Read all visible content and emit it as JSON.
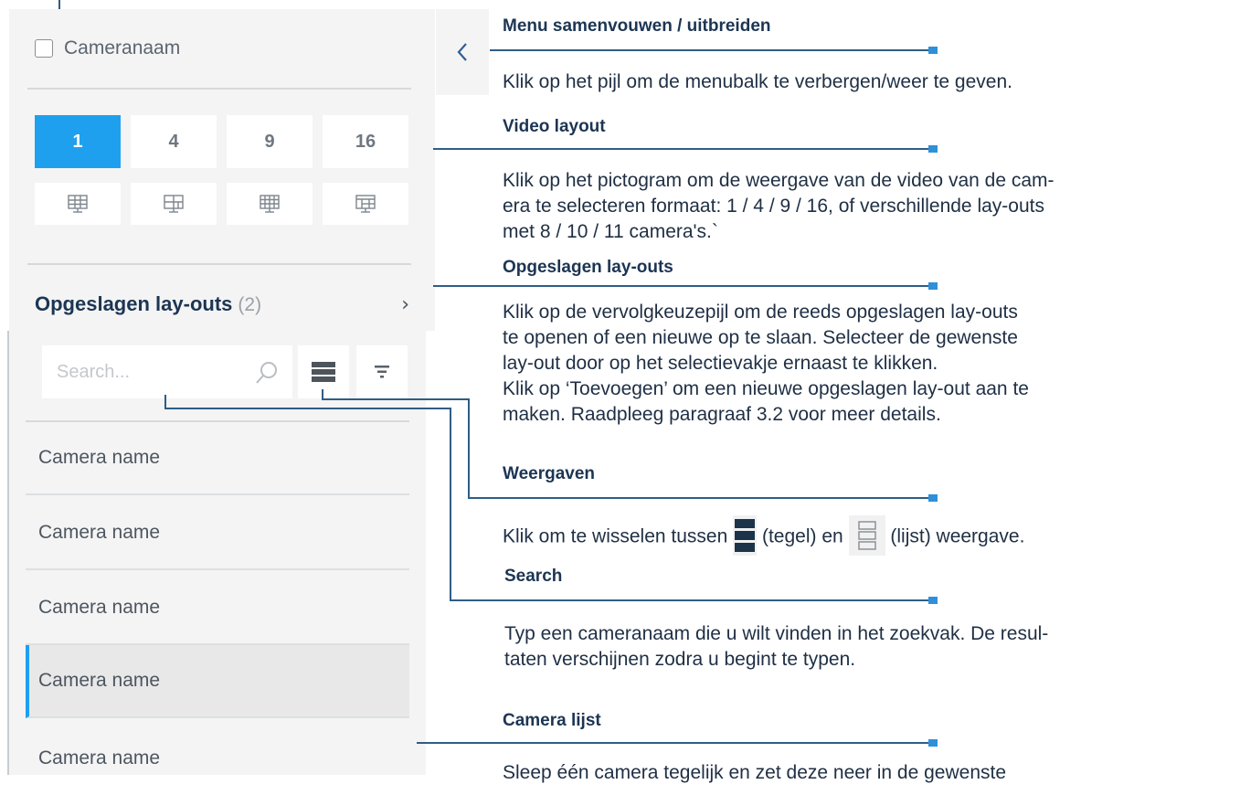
{
  "sidebar": {
    "camera_name_checkbox": {
      "label": "Cameranaam",
      "checked": false
    },
    "layout_buttons": [
      "1",
      "4",
      "9",
      "16"
    ],
    "active_layout": "1",
    "saved_layouts": {
      "title": "Opgeslagen lay-outs",
      "count": "(2)"
    },
    "search": {
      "placeholder": "Search..."
    },
    "camera_list": [
      "Camera name",
      "Camera name",
      "Camera name",
      "Camera name",
      "Camera name"
    ],
    "selected_index": 3,
    "accent_color": "#1ea0ef"
  },
  "icons": {
    "collapse": "chevron-left-icon",
    "saved_layouts_expand": "chevron-right-icon",
    "search": "magnifier-icon",
    "view_toggle": "tile-view-icon",
    "filter": "filter-icon"
  },
  "annotations": {
    "menu": {
      "title": "Menu samenvouwen / uitbreiden",
      "line1": "Klik op het pijl om de menubalk te verbergen/weer te geven."
    },
    "video_layout": {
      "title": "Video layout",
      "line1": "Klik op het pictogram om de weergave van de video van de cam-",
      "line2": "era te selecteren formaat: 1 / 4 / 9 / 16, of verschillende lay-outs",
      "line3": "met 8 / 10 / 11 camera's.`"
    },
    "saved": {
      "title": "Opgeslagen lay-outs",
      "line1": "Klik op de vervolgkeuzepijl om de reeds opgeslagen lay-outs",
      "line2": "te openen of een nieuwe op te slaan. Selecteer de gewenste",
      "line3": "lay-out door op het selectievakje ernaast te klikken.",
      "line4": "Klik op ‘Toevoegen’ om een nieuwe opgeslagen lay-out aan te",
      "line5": "maken. Raadpleeg paragraaf 3.2 voor meer details."
    },
    "views": {
      "title": "Weergaven",
      "part1": "Klik om te wisselen tussen",
      "part2": "(tegel) en",
      "part3": "(lijst) weergave."
    },
    "search": {
      "title": "Search",
      "line1": "Typ een cameranaam die u wilt vinden in het zoekvak. De resul-",
      "line2": "taten verschijnen zodra u begint te typen."
    },
    "camera_list": {
      "title": "Camera lijst",
      "line1": "Sleep één camera tegelijk en zet deze neer in de gewenste"
    }
  },
  "colors": {
    "line": "#2e5d86",
    "dot": "#2e90d8",
    "panel_bg": "#f4f4f4"
  }
}
